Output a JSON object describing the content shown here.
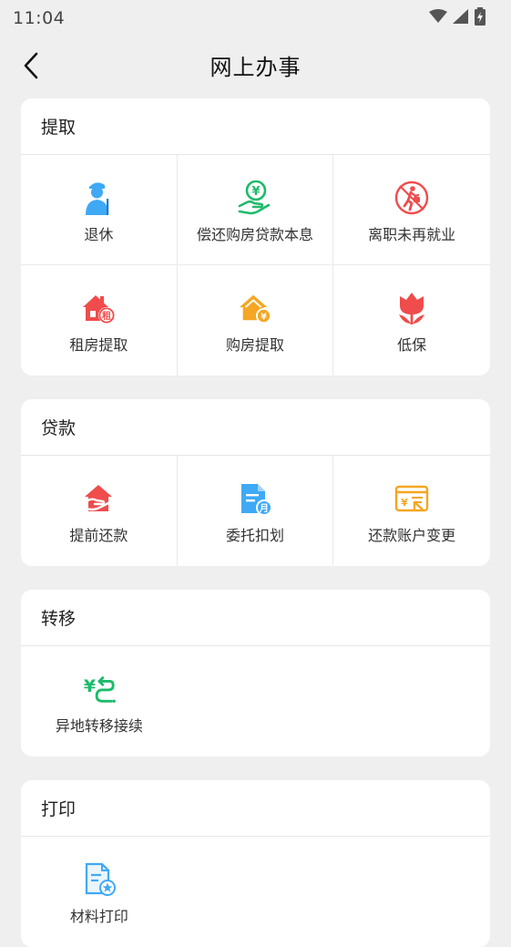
{
  "status": {
    "time": "11:04"
  },
  "header": {
    "title": "网上办事"
  },
  "sections": [
    {
      "title": "提取",
      "items": [
        {
          "label": "退休",
          "icon": "retire-icon"
        },
        {
          "label": "偿还购房贷款本息",
          "icon": "repay-loan-icon"
        },
        {
          "label": "离职未再就业",
          "icon": "resign-icon"
        },
        {
          "label": "租房提取",
          "icon": "rent-house-icon"
        },
        {
          "label": "购房提取",
          "icon": "buy-house-icon"
        },
        {
          "label": "低保",
          "icon": "tulip-icon"
        }
      ]
    },
    {
      "title": "贷款",
      "items": [
        {
          "label": "提前还款",
          "icon": "prepay-icon"
        },
        {
          "label": "委托扣划",
          "icon": "monthly-doc-icon"
        },
        {
          "label": "还款账户变更",
          "icon": "account-change-icon"
        }
      ]
    },
    {
      "title": "转移",
      "items": [
        {
          "label": "异地转移接续",
          "icon": "transfer-icon"
        }
      ]
    },
    {
      "title": "打印",
      "items": [
        {
          "label": "材料打印",
          "icon": "print-doc-icon"
        }
      ]
    }
  ],
  "colors": {
    "blue": "#3fa9f5",
    "green": "#1dbb6a",
    "red": "#f04c4c",
    "orange": "#f5a623",
    "background": "#efefef"
  }
}
